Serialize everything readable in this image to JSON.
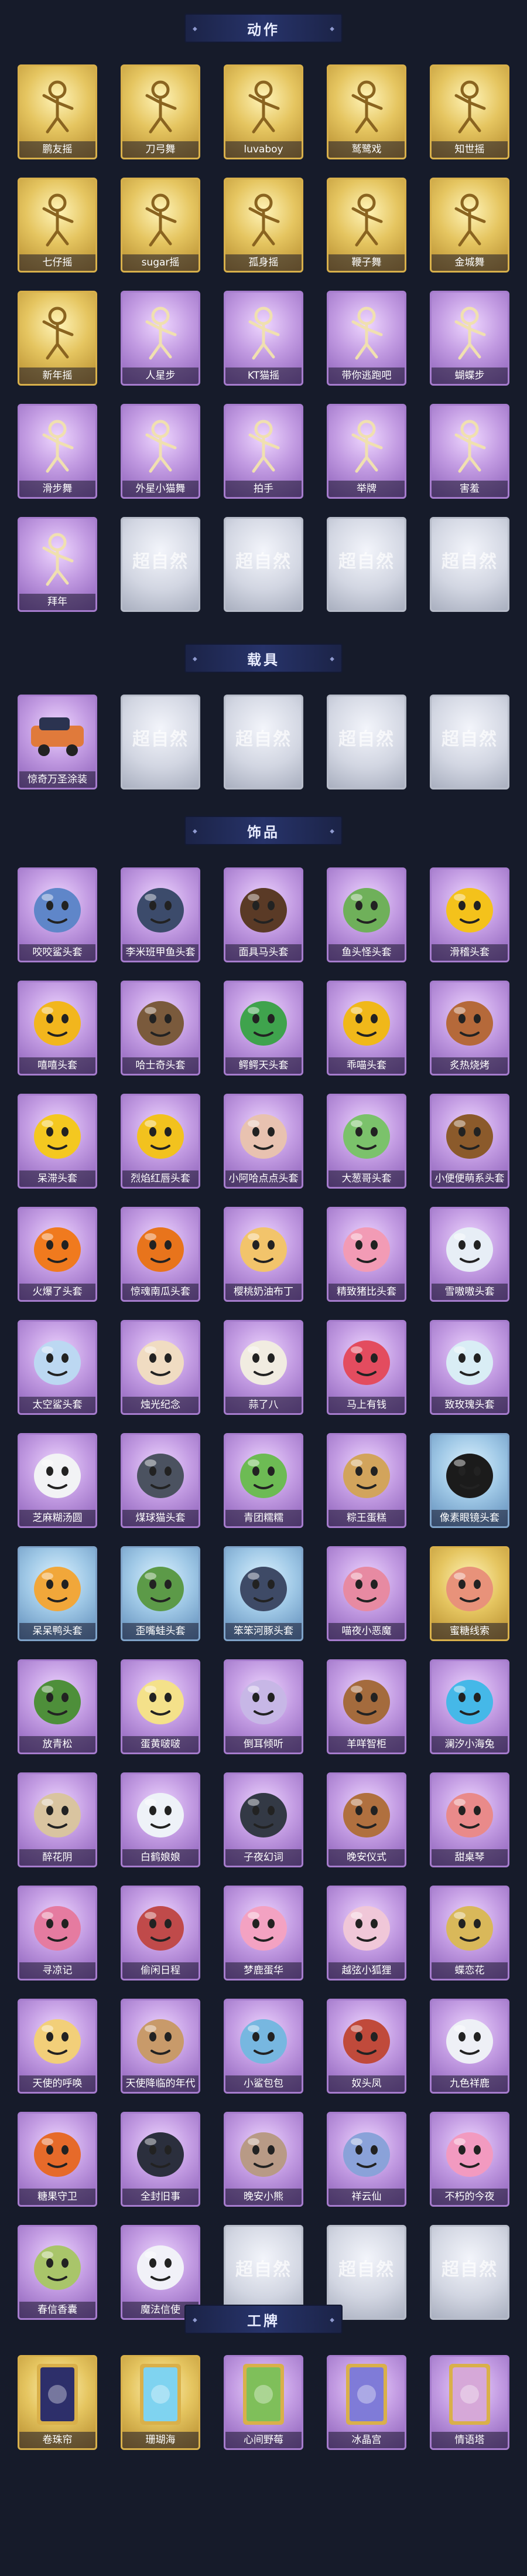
{
  "sections": [
    {
      "key": "actions",
      "title": "动作"
    },
    {
      "key": "vehicles",
      "title": "载具"
    },
    {
      "key": "accessories",
      "title": "饰品"
    },
    {
      "key": "badges",
      "title": "工牌"
    }
  ],
  "placeholder_text": "超自然",
  "actions": [
    {
      "label": "鹏友摇",
      "tier": "gold",
      "icon": "figure-pose-icon"
    },
    {
      "label": "刀弓舞",
      "tier": "gold",
      "icon": "figure-pose-icon"
    },
    {
      "label": "luvaboy",
      "tier": "gold",
      "icon": "figure-pose-icon"
    },
    {
      "label": "鹫鹭戏",
      "tier": "gold",
      "icon": "figure-pose-icon"
    },
    {
      "label": "知世摇",
      "tier": "gold",
      "icon": "figure-pose-icon"
    },
    {
      "label": "七仔摇",
      "tier": "gold",
      "icon": "figure-pose-icon"
    },
    {
      "label": "sugar摇",
      "tier": "gold",
      "icon": "figure-pose-icon"
    },
    {
      "label": "孤身摇",
      "tier": "gold",
      "icon": "figure-pose-icon"
    },
    {
      "label": "鞭子舞",
      "tier": "gold",
      "icon": "figure-pose-icon"
    },
    {
      "label": "金城舞",
      "tier": "gold",
      "icon": "figure-pose-icon"
    },
    {
      "label": "新年摇",
      "tier": "gold",
      "icon": "figure-pose-icon"
    },
    {
      "label": "人星步",
      "tier": "purple",
      "icon": "figure-pose-icon"
    },
    {
      "label": "KT猫摇",
      "tier": "purple",
      "icon": "figure-pose-icon"
    },
    {
      "label": "带你逃跑吧",
      "tier": "purple",
      "icon": "figure-pose-icon"
    },
    {
      "label": "蝴蝶步",
      "tier": "purple",
      "icon": "figure-pose-icon"
    },
    {
      "label": "滑步舞",
      "tier": "purple",
      "icon": "figure-pose-icon"
    },
    {
      "label": "外星小猫舞",
      "tier": "purple",
      "icon": "figure-pose-icon"
    },
    {
      "label": "拍手",
      "tier": "purple",
      "icon": "figure-pose-icon"
    },
    {
      "label": "举牌",
      "tier": "purple",
      "icon": "figure-pose-icon"
    },
    {
      "label": "害羞",
      "tier": "purple",
      "icon": "figure-pose-icon"
    },
    {
      "label": "拜年",
      "tier": "purple",
      "icon": "figure-pose-icon"
    },
    {
      "label": "",
      "tier": "silver",
      "icon": "placeholder-icon"
    },
    {
      "label": "",
      "tier": "silver",
      "icon": "placeholder-icon"
    },
    {
      "label": "",
      "tier": "silver",
      "icon": "placeholder-icon"
    },
    {
      "label": "",
      "tier": "silver",
      "icon": "placeholder-icon"
    }
  ],
  "vehicles": [
    {
      "label": "惊奇万圣涂装",
      "tier": "purple",
      "icon": "car-icon"
    },
    {
      "label": "",
      "tier": "silver",
      "icon": "placeholder-icon"
    },
    {
      "label": "",
      "tier": "silver",
      "icon": "placeholder-icon"
    },
    {
      "label": "",
      "tier": "silver",
      "icon": "placeholder-icon"
    },
    {
      "label": "",
      "tier": "silver",
      "icon": "placeholder-icon"
    }
  ],
  "accessories": [
    {
      "label": "咬咬鲨头套",
      "tier": "purple",
      "icon": "shark-head-icon",
      "c": "#5f86c9"
    },
    {
      "label": "李米班甲鱼头套",
      "tier": "purple",
      "icon": "fish-head-icon",
      "c": "#3c4b6b"
    },
    {
      "label": "面具马头套",
      "tier": "purple",
      "icon": "horse-head-icon",
      "c": "#5a3a26"
    },
    {
      "label": "鱼头怪头套",
      "tier": "purple",
      "icon": "fish-monster-icon",
      "c": "#6fb05a"
    },
    {
      "label": "滑稽头套",
      "tier": "purple",
      "icon": "emoji-face-icon",
      "c": "#f4c21b"
    },
    {
      "label": "嘻嘻头套",
      "tier": "purple",
      "icon": "emoji-face-icon",
      "c": "#f2b61d"
    },
    {
      "label": "哈士奇头套",
      "tier": "purple",
      "icon": "dog-head-icon",
      "c": "#7a5a3c"
    },
    {
      "label": "鳄鳄天头套",
      "tier": "purple",
      "icon": "crocodile-head-icon",
      "c": "#3fa34d"
    },
    {
      "label": "乖喵头套",
      "tier": "purple",
      "icon": "emoji-face-icon",
      "c": "#f0b81a"
    },
    {
      "label": "炙热烧烤",
      "tier": "purple",
      "icon": "bbq-icon",
      "c": "#b5693a"
    },
    {
      "label": "呆滞头套",
      "tier": "purple",
      "icon": "emoji-face-icon",
      "c": "#f4c820"
    },
    {
      "label": "烈焰红唇头套",
      "tier": "purple",
      "icon": "yellow-monster-icon",
      "c": "#f2c21e"
    },
    {
      "label": "小阿哈点点头套",
      "tier": "purple",
      "icon": "blob-head-icon",
      "c": "#e8c2b0"
    },
    {
      "label": "大葱哥头套",
      "tier": "purple",
      "icon": "onion-head-icon",
      "c": "#7bc26b"
    },
    {
      "label": "小便便萌系头套",
      "tier": "purple",
      "icon": "poop-head-icon",
      "c": "#8b5a2b"
    },
    {
      "label": "火爆了头套",
      "tier": "purple",
      "icon": "fire-head-icon",
      "c": "#f07a1e"
    },
    {
      "label": "惊魂南瓜头套",
      "tier": "purple",
      "icon": "pumpkin-head-icon",
      "c": "#e8741c"
    },
    {
      "label": "樱桃奶油布丁",
      "tier": "purple",
      "icon": "pudding-icon",
      "c": "#f2c46b"
    },
    {
      "label": "精致猪比头套",
      "tier": "purple",
      "icon": "pig-head-icon",
      "c": "#f29bb5"
    },
    {
      "label": "雪嗷嗷头套",
      "tier": "purple",
      "icon": "snow-head-icon",
      "c": "#e7eef6"
    },
    {
      "label": "太空鲨头套",
      "tier": "purple",
      "icon": "space-shark-icon",
      "c": "#bcd8f2"
    },
    {
      "label": "烛光纪念",
      "tier": "purple",
      "icon": "candle-icon",
      "c": "#f0dcc2"
    },
    {
      "label": "蒜了八",
      "tier": "purple",
      "icon": "garlic-icon",
      "c": "#f1ece1"
    },
    {
      "label": "马上有钱",
      "tier": "purple",
      "icon": "money-head-icon",
      "c": "#e34c5f"
    },
    {
      "label": "致玫瑰头套",
      "tier": "purple",
      "icon": "cloud-head-icon",
      "c": "#d9edf5"
    },
    {
      "label": "芝麻糊汤圆",
      "tier": "purple",
      "icon": "tangyuan-icon",
      "c": "#f2f3f5"
    },
    {
      "label": "煤球猫头套",
      "tier": "purple",
      "icon": "cat-head-icon",
      "c": "#4b5260"
    },
    {
      "label": "青团糯糯",
      "tier": "purple",
      "icon": "qingtuan-icon",
      "c": "#6dbb54"
    },
    {
      "label": "粽王蛋糕",
      "tier": "purple",
      "icon": "zongzi-icon",
      "c": "#d2a45c"
    },
    {
      "label": "像素眼镜头套",
      "tier": "blue",
      "icon": "pixel-glasses-icon",
      "c": "#1b1b1b"
    },
    {
      "label": "呆呆鸭头套",
      "tier": "blue",
      "icon": "duck-head-icon",
      "c": "#f1a73a"
    },
    {
      "label": "歪嘴蛙头套",
      "tier": "blue",
      "icon": "frog-head-icon",
      "c": "#5c9a48"
    },
    {
      "label": "笨笨河豚头套",
      "tier": "blue",
      "icon": "puffer-head-icon",
      "c": "#3e4a66"
    },
    {
      "label": "喵夜小恶魔",
      "tier": "purple",
      "icon": "devil-girl-icon",
      "c": "#e78aa2"
    },
    {
      "label": "蜜糖线索",
      "tier": "gold",
      "icon": "bear-plush-icon",
      "c": "#e8927a"
    },
    {
      "label": "放青松",
      "tier": "purple",
      "icon": "bonsai-icon",
      "c": "#4e8f3a"
    },
    {
      "label": "蛋黄啵啵",
      "tier": "purple",
      "icon": "egg-plush-icon",
      "c": "#f4e18a"
    },
    {
      "label": "倒耳倾听",
      "tier": "purple",
      "icon": "ear-plush-icon",
      "c": "#c7b7e6"
    },
    {
      "label": "羊咩智柜",
      "tier": "purple",
      "icon": "sheep-cabinet-icon",
      "c": "#a46b3d"
    },
    {
      "label": "澜汐小海兔",
      "tier": "purple",
      "icon": "blue-cat-icon",
      "c": "#45b8e8"
    },
    {
      "label": "醉花阴",
      "tier": "purple",
      "icon": "flower-tassel-icon",
      "c": "#d9c4a0"
    },
    {
      "label": "白鹤娘娘",
      "tier": "purple",
      "icon": "white-ghost-icon",
      "c": "#eef2f8"
    },
    {
      "label": "子夜幻词",
      "tier": "purple",
      "icon": "crow-doll-icon",
      "c": "#333945"
    },
    {
      "label": "晚安仪式",
      "tier": "purple",
      "icon": "girl-doll-icon",
      "c": "#b0703f"
    },
    {
      "label": "甜桌琴",
      "tier": "purple",
      "icon": "pink-plush-icon",
      "c": "#e98a8a"
    },
    {
      "label": "寻凉记",
      "tier": "purple",
      "icon": "umbrella-doll-icon",
      "c": "#e57ba0"
    },
    {
      "label": "偷闲日程",
      "tier": "purple",
      "icon": "chibi-hat-icon",
      "c": "#c04a4a"
    },
    {
      "label": "梦鹿蛋华",
      "tier": "purple",
      "icon": "deer-doll-icon",
      "c": "#f3a2c2"
    },
    {
      "label": "越弦小狐狸",
      "tier": "purple",
      "icon": "fox-plush-icon",
      "c": "#f0c7d8"
    },
    {
      "label": "蝶恋花",
      "tier": "purple",
      "icon": "butterfly-wreath-icon",
      "c": "#d9b85a"
    },
    {
      "label": "天使的呼唤",
      "tier": "purple",
      "icon": "angel-doll-icon",
      "c": "#f2cf79"
    },
    {
      "label": "天使降临的年代",
      "tier": "purple",
      "icon": "angel-girl-icon",
      "c": "#c89a6a"
    },
    {
      "label": "小鲨包包",
      "tier": "purple",
      "icon": "shark-bag-icon",
      "c": "#77b7e0"
    },
    {
      "label": "奴头凤",
      "tier": "purple",
      "icon": "phoenix-doll-icon",
      "c": "#c04a3b"
    },
    {
      "label": "九色祥鹿",
      "tier": "purple",
      "icon": "deer-figure-icon",
      "c": "#eef0f6"
    },
    {
      "label": "糖果守卫",
      "tier": "purple",
      "icon": "lantern-charm-icon",
      "c": "#e66a2a"
    },
    {
      "label": "全封旧事",
      "tier": "purple",
      "icon": "boy-figure-icon",
      "c": "#2b2f3d"
    },
    {
      "label": "晚安小熊",
      "tier": "purple",
      "icon": "bear-charm-icon",
      "c": "#b89a86"
    },
    {
      "label": "祥云仙",
      "tier": "purple",
      "icon": "cloud-charm-icon",
      "c": "#8aa2d9"
    },
    {
      "label": "不朽的今夜",
      "tier": "purple",
      "icon": "bunny-charm-icon",
      "c": "#f29ac0"
    },
    {
      "label": "春信香囊",
      "tier": "purple",
      "icon": "sachet-icon",
      "c": "#a9c56a"
    },
    {
      "label": "魔法信使",
      "tier": "purple",
      "icon": "mouse-plush-icon",
      "c": "#f1f1f8"
    },
    {
      "label": "",
      "tier": "silver",
      "icon": "placeholder-icon",
      "c": ""
    },
    {
      "label": "",
      "tier": "silver",
      "icon": "placeholder-icon",
      "c": ""
    },
    {
      "label": "",
      "tier": "silver",
      "icon": "placeholder-icon",
      "c": ""
    }
  ],
  "badges": [
    {
      "label": "卷珠帘",
      "tier": "gold",
      "icon": "card-frame-icon",
      "c": "#2d2f6a"
    },
    {
      "label": "珊瑚海",
      "tier": "gold",
      "icon": "card-frame-icon",
      "c": "#7fd3f0"
    },
    {
      "label": "心间野莓",
      "tier": "purple",
      "icon": "card-frame-icon",
      "c": "#7fbf5a"
    },
    {
      "label": "冰晶宫",
      "tier": "purple",
      "icon": "card-frame-icon",
      "c": "#7f7bd8"
    },
    {
      "label": "情语塔",
      "tier": "purple",
      "icon": "card-frame-icon",
      "c": "#d6a8d8"
    }
  ]
}
